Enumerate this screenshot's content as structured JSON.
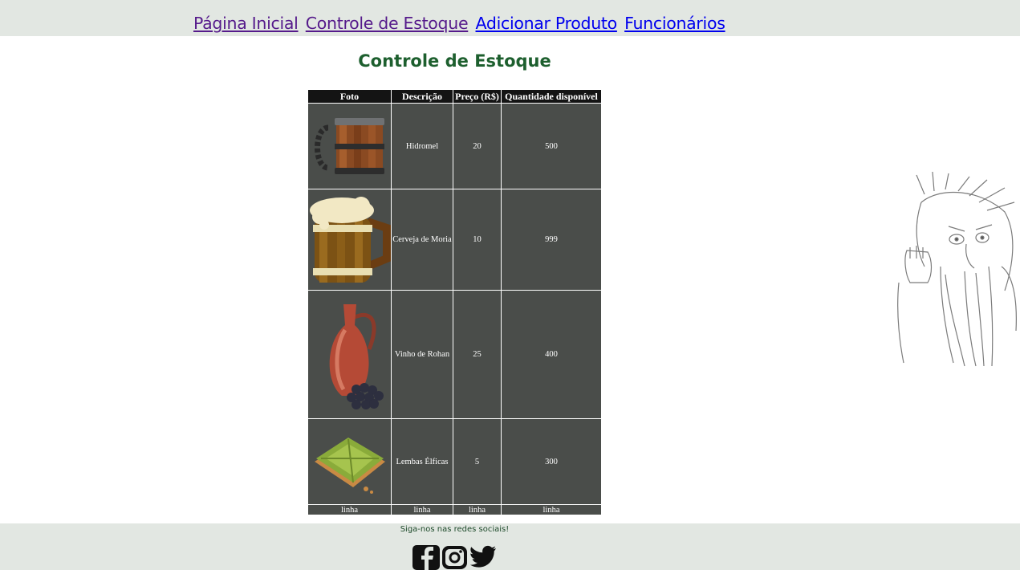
{
  "nav": {
    "items": [
      {
        "label": "Página Inicial",
        "state": "visited"
      },
      {
        "label": "Controle de Estoque",
        "state": "visited"
      },
      {
        "label": "Adicionar Produto",
        "state": "unvisited"
      },
      {
        "label": "Funcionários",
        "state": "unvisited"
      }
    ]
  },
  "page": {
    "title": "Controle de Estoque"
  },
  "table": {
    "headers": [
      "Foto",
      "Descrição",
      "Preço (R$)",
      "Quantidade disponível"
    ],
    "rows": [
      {
        "photo": "wooden-mug-icon",
        "description": "Hidromel",
        "price": "20",
        "quantity": "500"
      },
      {
        "photo": "beer-barrel-mug-icon",
        "description": "Cerveja de Moria",
        "price": "10",
        "quantity": "999"
      },
      {
        "photo": "wine-jug-grapes-icon",
        "description": "Vinho de Rohan",
        "price": "25",
        "quantity": "400"
      },
      {
        "photo": "leaf-bread-icon",
        "description": "Lembas Élficas",
        "price": "5",
        "quantity": "300"
      }
    ],
    "footer_row": [
      "linha",
      "linha",
      "linha",
      "linha"
    ]
  },
  "footer": {
    "text": "Siga-nos nas redes sociais!",
    "social": [
      "facebook-icon",
      "instagram-icon",
      "twitter-icon"
    ]
  },
  "decoration": {
    "illustration": "ent-sketch-illustration"
  },
  "colors": {
    "nav_bg": "#e2e7e2",
    "title": "#1d5f2e",
    "table_header_bg": "#141414",
    "table_cell_bg": "#4a4d4a",
    "link_visited": "#551a8b",
    "link_unvisited": "#0000ee"
  }
}
